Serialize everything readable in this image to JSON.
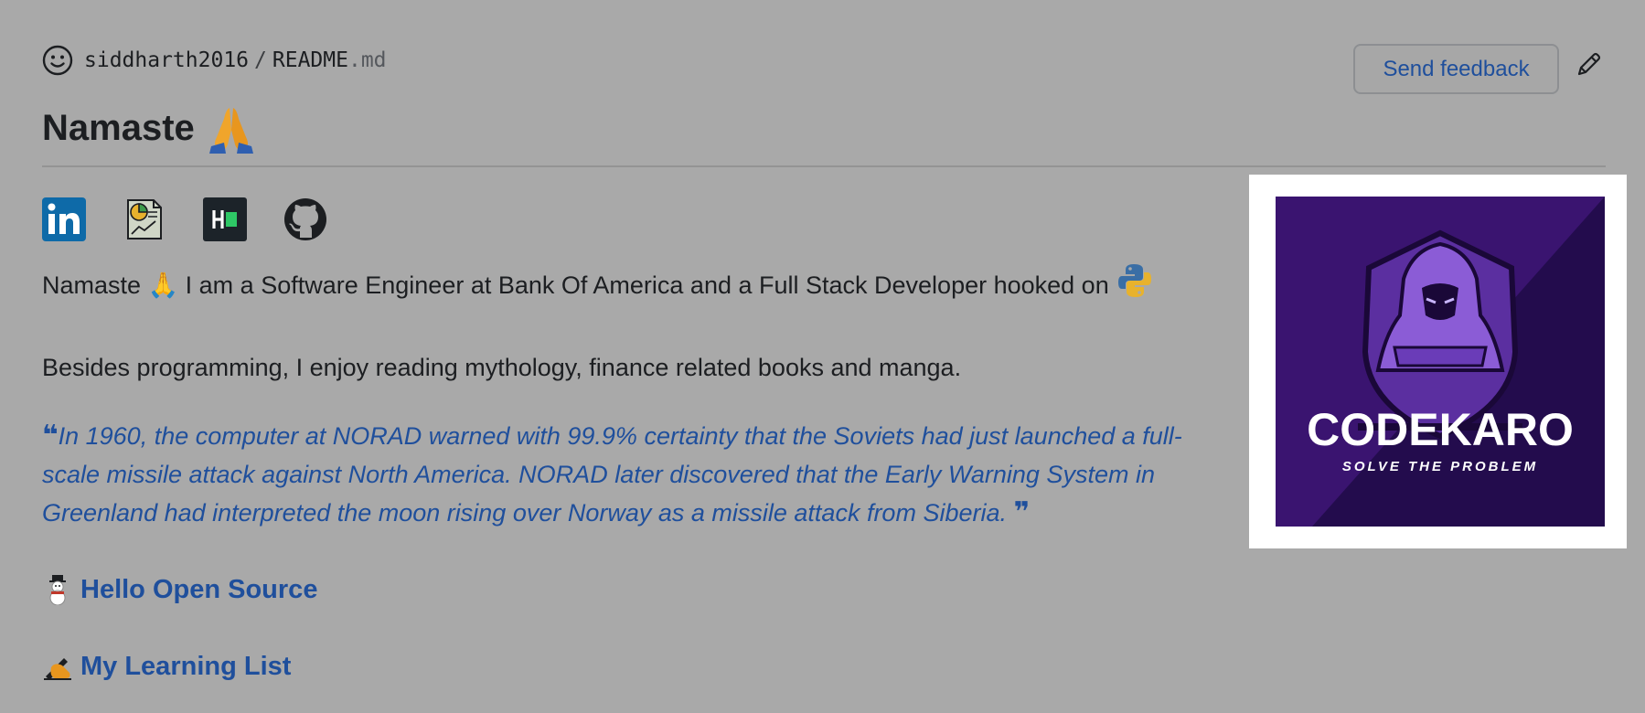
{
  "header": {
    "owner": "siddharth2016",
    "separator": "/",
    "file_name": "README",
    "file_ext": ".md",
    "feedback_label": "Send feedback"
  },
  "readme": {
    "title": "Namaste",
    "intro": "Namaste 🙏 I am a Software Engineer at Bank Of America and a Full Stack Developer hooked on",
    "hobbies": "Besides programming, I enjoy reading mythology, finance related books and manga.",
    "quote": "In 1960, the computer at NORAD warned with 99.9% certainty that the Soviets had just launched a full-scale missile attack against North America. NORAD later discovered that the Early Warning System in Greenland had interpreted the moon rising over Norway as a missile attack from Siberia.",
    "section_open_source": "Hello Open Source",
    "section_learning": "My Learning List",
    "logo_title": "CODEKARO",
    "logo_tagline": "SOLVE THE PROBLEM"
  },
  "colors": {
    "background": "#a9a9a9",
    "link": "#1f4f9c",
    "logo_purple": "#3a1470"
  },
  "icons": [
    "smiley-icon",
    "pencil-icon",
    "linkedin-icon",
    "report-icon",
    "hackerrank-icon",
    "github-icon",
    "python-icon",
    "snowman-icon",
    "writing-hand-icon",
    "folded-hands-icon"
  ]
}
